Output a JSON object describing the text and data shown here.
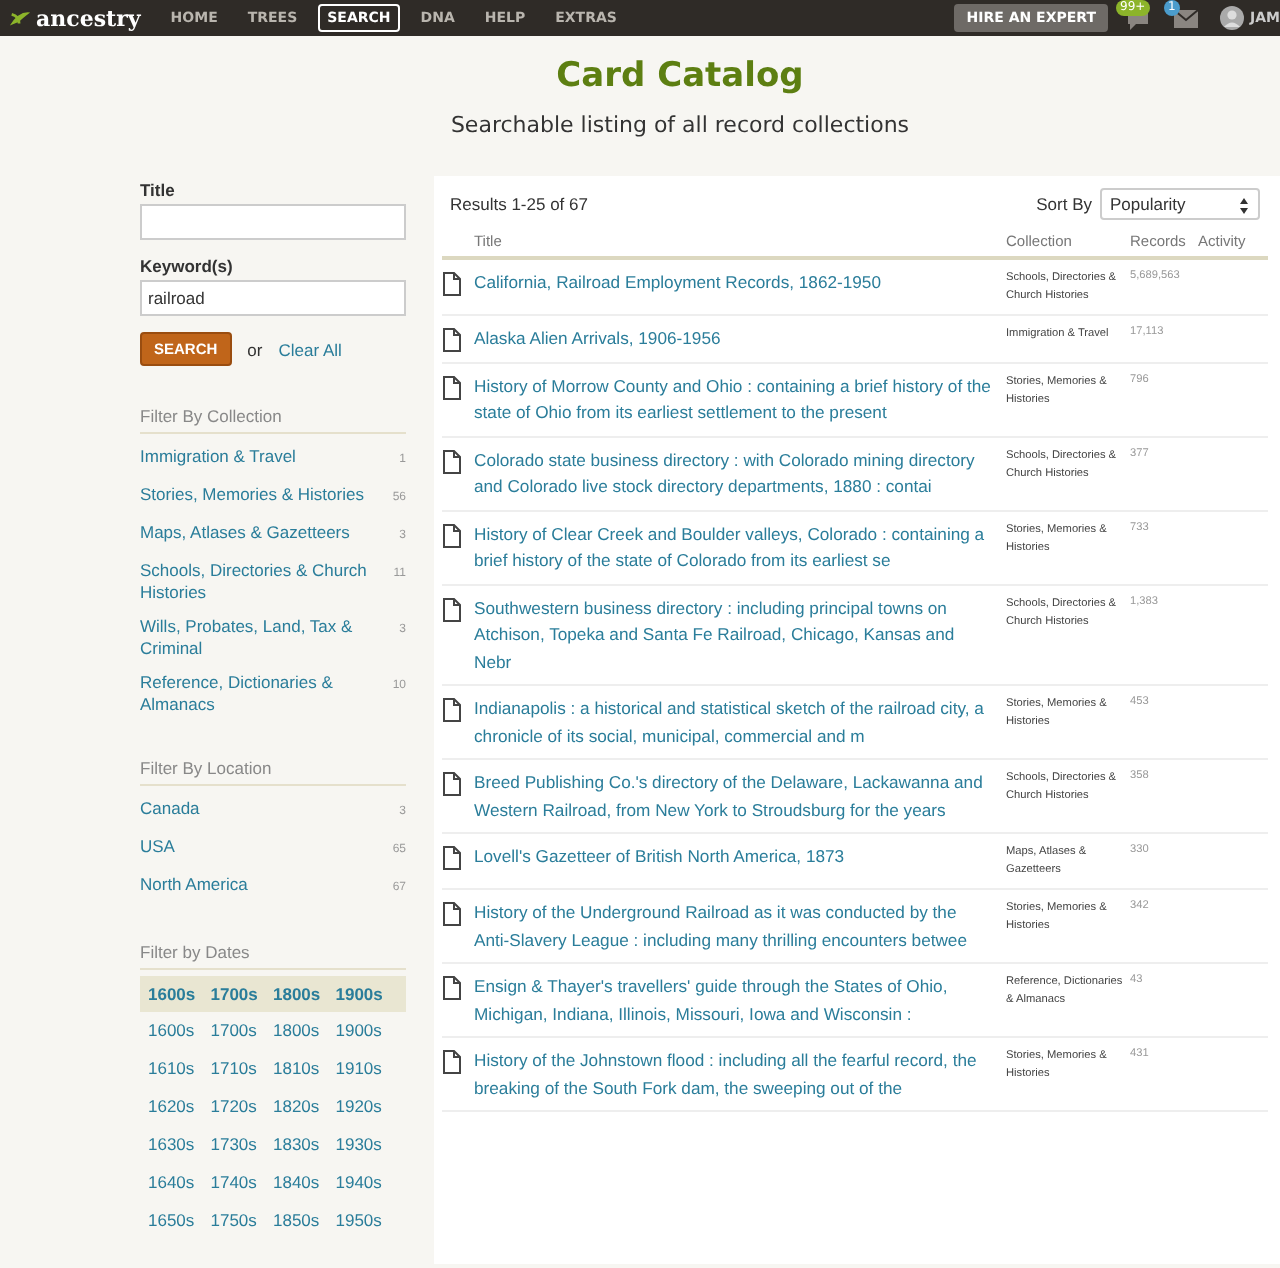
{
  "nav": {
    "logo": "ancestry",
    "items": [
      {
        "label": "HOME",
        "selected": false
      },
      {
        "label": "TREES",
        "selected": false
      },
      {
        "label": "SEARCH",
        "selected": true
      },
      {
        "label": "DNA",
        "selected": false
      },
      {
        "label": "HELP",
        "selected": false
      },
      {
        "label": "EXTRAS",
        "selected": false
      }
    ],
    "expert_button": "HIRE AN EXPERT",
    "badges": [
      {
        "kind": "chat",
        "count": "99+",
        "color": "#8cb42a"
      },
      {
        "kind": "mail",
        "count": "1",
        "color": "#4b9ccc"
      }
    ],
    "user": "JAM"
  },
  "header": {
    "title": "Card Catalog",
    "subtitle": "Searchable listing of all record collections"
  },
  "search_form": {
    "fields": [
      {
        "label": "Title"
      },
      {
        "label": "Keyword(s)",
        "value": "railroad"
      }
    ],
    "search_button": "SEARCH",
    "or": "or",
    "clear_link": "Clear All"
  },
  "filters": [
    {
      "title": "Filter By Collection",
      "items": [
        {
          "label": "Immigration & Travel",
          "count": "1"
        },
        {
          "label": "Stories, Memories & Histories",
          "count": "56"
        },
        {
          "label": "Maps, Atlases & Gazetteers",
          "count": "3"
        },
        {
          "label": "Schools, Directories & Church Histories",
          "count": "11"
        },
        {
          "label": "Wills, Probates, Land, Tax & Criminal",
          "count": "3"
        },
        {
          "label": "Reference, Dictionaries & Almanacs",
          "count": "10"
        }
      ]
    },
    {
      "title": "Filter By Location",
      "items": [
        {
          "label": "Canada",
          "count": "3"
        },
        {
          "label": "USA",
          "count": "65"
        },
        {
          "label": "North America",
          "count": "67"
        }
      ]
    }
  ],
  "date_filter": {
    "title": "Filter by Dates",
    "centuries": [
      "1600s",
      "1700s",
      "1800s",
      "1900s"
    ],
    "decades": [
      [
        "1600s",
        "1700s",
        "1800s",
        "1900s"
      ],
      [
        "1610s",
        "1710s",
        "1810s",
        "1910s"
      ],
      [
        "1620s",
        "1720s",
        "1820s",
        "1920s"
      ],
      [
        "1630s",
        "1730s",
        "1830s",
        "1930s"
      ],
      [
        "1640s",
        "1740s",
        "1840s",
        "1940s"
      ],
      [
        "1650s",
        "1750s",
        "1850s",
        "1950s"
      ]
    ]
  },
  "results": {
    "summary": "Results 1-25 of 67",
    "sort_label": "Sort By",
    "sort_value": "Popularity",
    "columns": [
      "Title",
      "Collection",
      "Records",
      "Activity"
    ],
    "rows": [
      {
        "title": "California, Railroad Employment Records, 1862-1950",
        "collection": "Schools, Directories & Church Histories",
        "records": "5,689,563"
      },
      {
        "title": "Alaska Alien Arrivals, 1906-1956",
        "collection": "Immigration & Travel",
        "records": "17,113"
      },
      {
        "title": "History of Morrow County and Ohio : containing a brief history of the state of Ohio from its earliest settlement to the present",
        "collection": "Stories, Memories & Histories",
        "records": "796"
      },
      {
        "title": "Colorado state business directory : with Colorado mining directory and Colorado live stock directory departments, 1880 : contai",
        "collection": "Schools, Directories & Church Histories",
        "records": "377"
      },
      {
        "title": "History of Clear Creek and Boulder valleys, Colorado : containing a brief history of the state of Colorado from its earliest se",
        "collection": "Stories, Memories & Histories",
        "records": "733"
      },
      {
        "title": "Southwestern business directory : including principal towns on Atchison, Topeka and Santa Fe Railroad, Chicago, Kansas and Nebr",
        "collection": "Schools, Directories & Church Histories",
        "records": "1,383"
      },
      {
        "title": "Indianapolis : a historical and statistical sketch of the railroad city, a chronicle of its social, municipal, commercial and m",
        "collection": "Stories, Memories & Histories",
        "records": "453"
      },
      {
        "title": "Breed Publishing Co.'s directory of the Delaware, Lackawanna and Western Railroad, from New York to Stroudsburg for the years",
        "collection": "Schools, Directories & Church Histories",
        "records": "358"
      },
      {
        "title": "Lovell's Gazetteer of British North America, 1873",
        "collection": "Maps, Atlases & Gazetteers",
        "records": "330"
      },
      {
        "title": "History of the Underground Railroad as it was conducted by the Anti-Slavery League : including many thrilling encounters betwee",
        "collection": "Stories, Memories & Histories",
        "records": "342"
      },
      {
        "title": "Ensign & Thayer's travellers' guide through the States of Ohio, Michigan, Indiana, Illinois, Missouri, Iowa and Wisconsin :",
        "collection": "Reference, Dictionaries & Almanacs",
        "records": "43"
      },
      {
        "title": "History of the Johnstown flood : including all the fearful record, the breaking of the South Fork dam, the sweeping out of the",
        "collection": "Stories, Memories & Histories",
        "records": "431"
      }
    ]
  }
}
